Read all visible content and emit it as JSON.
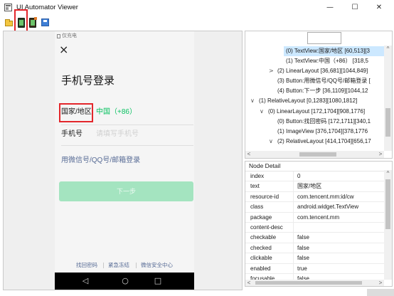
{
  "window": {
    "title": "UI Automator Viewer",
    "controls": {
      "minimize": "—",
      "maximize": "☐",
      "close": "✕"
    }
  },
  "toolbar": {
    "icons": [
      "open-folder-icon",
      "device-screenshot-icon",
      "device-screenshot-compressed-icon",
      "save-icon"
    ]
  },
  "device": {
    "status_text": "仅充电",
    "close_glyph": "×",
    "page_title": "手机号登录",
    "country_label": "国家/地区",
    "country_value": "中国（+86）",
    "phone_label": "手机号",
    "phone_placeholder": "请填写手机号",
    "alt_login_link": "用微信号/QQ号/邮箱登录",
    "next_button": "下一步",
    "footer_links": [
      "找回密码",
      "紧急冻结",
      "微信安全中心"
    ],
    "nav": {
      "back": "◁",
      "home": "○",
      "recent": "□"
    }
  },
  "tree": {
    "rows": [
      {
        "text": "(0) TextView:国家/地区 [60,513][3"
      },
      {
        "text": "(1) TextView:中国（+86） [318,5"
      },
      {
        "toggle": ">",
        "text": "(2) LinearLayout [36,681][1044,849]"
      },
      {
        "text": "(3) Button:用微信号/QQ号/邮箱登录 ["
      },
      {
        "text": "(4) Button:下一步 [36,1109][1044,12"
      },
      {
        "toggle": "∨",
        "text": "(1) RelativeLayout [0,1283][1080,1812]"
      },
      {
        "toggle": "∨",
        "text": "(0) LinearLayout [172,1704][908,1776]"
      },
      {
        "text": "(0) Button:找回密码 [172,1711][340,1"
      },
      {
        "text": "(1) ImageView [376,1704][378,1776"
      },
      {
        "toggle": "∨",
        "text": "(2) RelativeLayout [414,1704][656,17"
      }
    ]
  },
  "node_detail": {
    "title": "Node Detail",
    "rows": [
      {
        "key": "index",
        "value": "0"
      },
      {
        "key": "text",
        "value": "国家/地区"
      },
      {
        "key": "resource-id",
        "value": "com.tencent.mm:id/cw"
      },
      {
        "key": "class",
        "value": "android.widget.TextView"
      },
      {
        "key": "package",
        "value": "com.tencent.mm"
      },
      {
        "key": "content-desc",
        "value": ""
      },
      {
        "key": "checkable",
        "value": "false"
      },
      {
        "key": "checked",
        "value": "false"
      },
      {
        "key": "clickable",
        "value": "false"
      },
      {
        "key": "enabled",
        "value": "true"
      },
      {
        "key": "focusable",
        "value": "false"
      }
    ]
  },
  "scroll": {
    "up": "^",
    "left": "<",
    "right": ">"
  },
  "colors": {
    "accent_green": "#07c160",
    "link_blue": "#576b95",
    "annotation_red": "#e3262b",
    "tree_selection": "#cce8ff",
    "next_button_green": "#a4e4c0"
  }
}
